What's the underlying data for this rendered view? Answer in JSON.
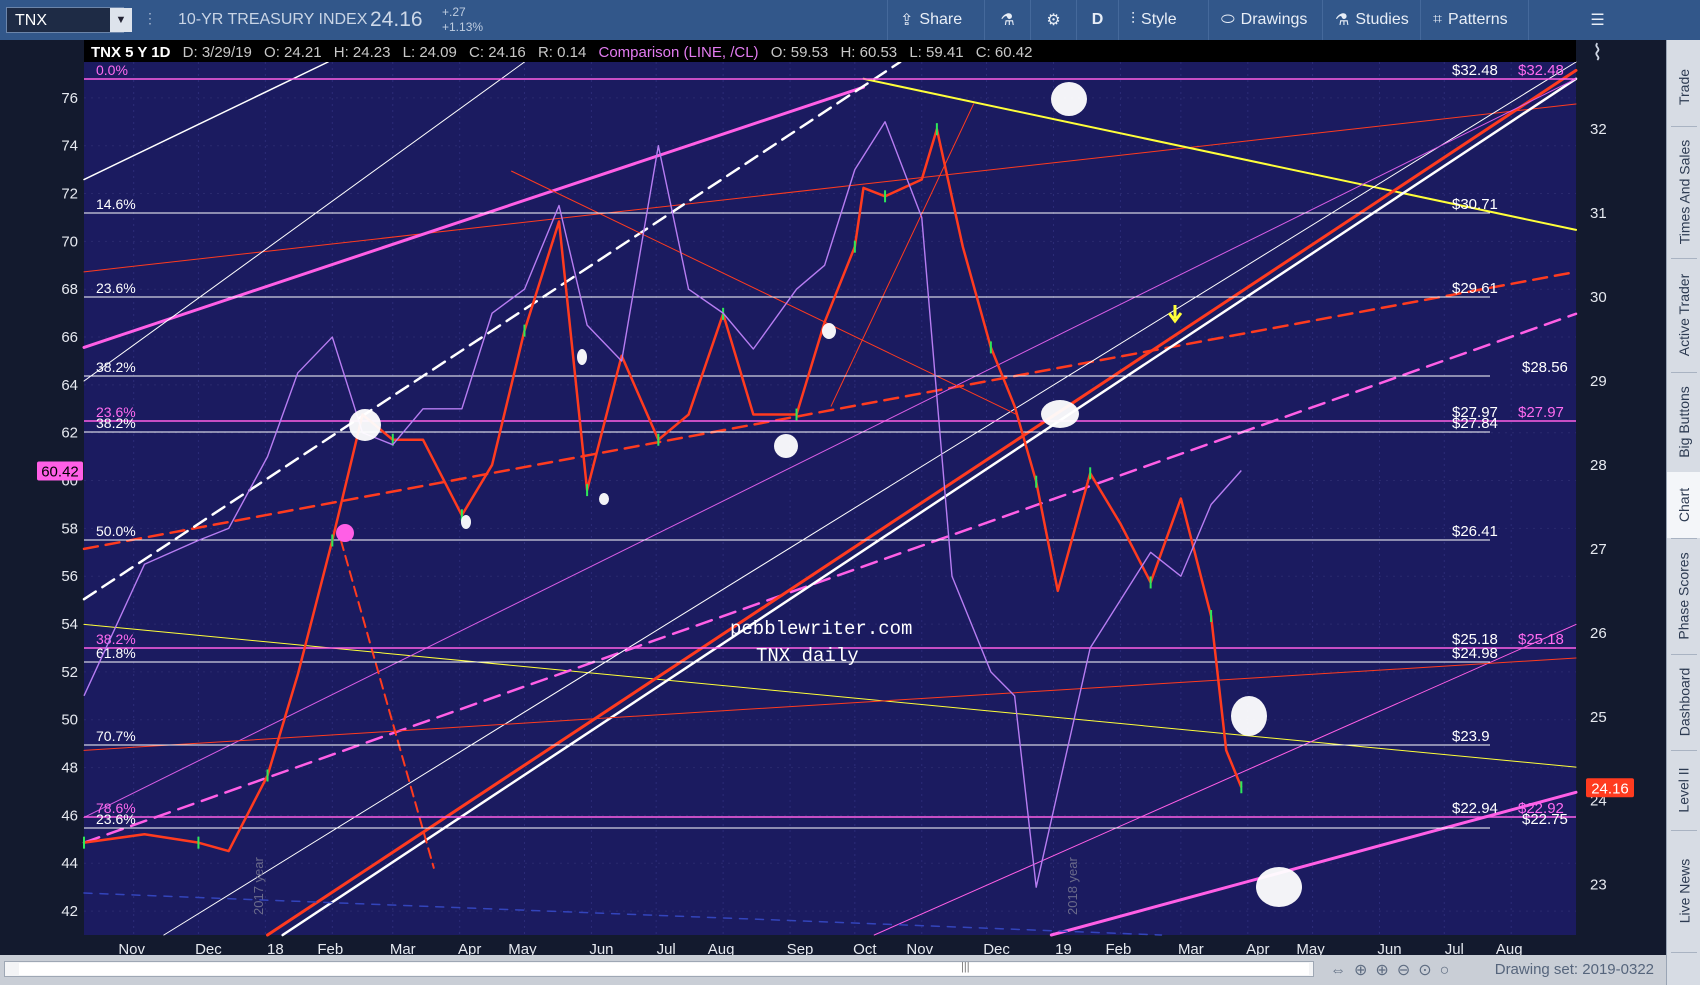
{
  "toolbar": {
    "symbol": "TNX",
    "dropdown_icon": "chevron-down-icon",
    "name": "10-YR TREASURY INDEX",
    "last": "24.16",
    "change": "+.27",
    "change_pct": "+1.13%",
    "share": "Share",
    "period": "D",
    "style": "Style",
    "drawings": "Drawings",
    "studies": "Studies",
    "patterns": "Patterns"
  },
  "header": {
    "title": "TNX 5 Y 1D",
    "date": "D: 3/29/19",
    "open": "O: 24.21",
    "high": "H: 24.23",
    "low": "L: 24.09",
    "close": "C: 24.16",
    "range": "R: 0.14",
    "comparison": "Comparison (LINE, /CL)",
    "c_open": "O: 59.53",
    "c_high": "H: 60.53",
    "c_low": "L: 59.41",
    "c_close": "C: 60.42"
  },
  "sidebar": {
    "tabs": [
      "Trade",
      "Times And Sales",
      "Active Trader",
      "Big Buttons",
      "Chart",
      "Phase Scores",
      "Dashboard",
      "Level II",
      "Live News"
    ],
    "active": "Chart"
  },
  "bottombar": {
    "drawing_set": "Drawing set: 2019-0322"
  },
  "chart_data": {
    "type": "line",
    "annotations": [
      "pebblewriter.com",
      "TNX daily",
      "2017 year",
      "2018 year"
    ],
    "x_ticks": [
      "Nov",
      "Dec",
      "18",
      "Feb",
      "Mar",
      "Apr",
      "May",
      "Jun",
      "Jul",
      "Aug",
      "Sep",
      "Oct",
      "Nov",
      "Dec",
      "19",
      "Feb",
      "Mar",
      "Apr",
      "May",
      "Jun",
      "Jul",
      "Aug"
    ],
    "left_axis": {
      "range": [
        41,
        77.5
      ],
      "ticks": [
        42,
        44,
        46,
        48,
        50,
        52,
        54,
        56,
        58,
        60,
        62,
        64,
        66,
        68,
        70,
        72,
        74,
        76
      ],
      "marker": "60.42"
    },
    "right_axis": {
      "range": [
        22.4,
        32.8
      ],
      "ticks": [
        23,
        24,
        25,
        26,
        27,
        28,
        29,
        30,
        31,
        32
      ],
      "marker": "24.16"
    },
    "fib_levels": [
      {
        "pct": "0.0%",
        "value": "$32.48",
        "right_tag": "$32.48"
      },
      {
        "pct": "14.6%",
        "value": "$30.71"
      },
      {
        "pct": "23.6%",
        "value": "$29.61"
      },
      {
        "pct": "38.2%",
        "value": "$28.56"
      },
      {
        "pct": "23.6%",
        "value": "$27.97",
        "right_tag": "$27.97"
      },
      {
        "pct": "38.2%",
        "value": "$27.84"
      },
      {
        "pct": "50.0%",
        "value": "$26.41"
      },
      {
        "pct": "38.2%",
        "value": "$25.18",
        "right_tag": "$25.18"
      },
      {
        "pct": "61.8%",
        "value": "$24.98"
      },
      {
        "pct": "70.7%",
        "value": "$23.9"
      },
      {
        "pct": "78.6%",
        "value": "$22.94",
        "right_tag": "$22.92"
      },
      {
        "pct": "23.6%",
        "value": "$22.75"
      }
    ],
    "series": [
      {
        "name": "TNX",
        "x": [
          "2017-10-09",
          "2017-11-06",
          "2017-12-01",
          "2017-12-15",
          "2018-01-02",
          "2018-01-16",
          "2018-02-01",
          "2018-02-15",
          "2018-03-01",
          "2018-03-15",
          "2018-04-02",
          "2018-04-16",
          "2018-05-01",
          "2018-05-17",
          "2018-05-30",
          "2018-06-15",
          "2018-07-02",
          "2018-07-16",
          "2018-08-01",
          "2018-08-15",
          "2018-09-04",
          "2018-09-17",
          "2018-10-01",
          "2018-10-05",
          "2018-10-15",
          "2018-11-01",
          "2018-11-08",
          "2018-11-20",
          "2018-12-03",
          "2018-12-14",
          "2018-12-24",
          "2019-01-03",
          "2019-01-18",
          "2019-02-01",
          "2019-02-15",
          "2019-03-01",
          "2019-03-15",
          "2019-03-22",
          "2019-03-29"
        ],
        "values": [
          23.5,
          23.6,
          23.5,
          23.4,
          24.3,
          25.5,
          27.1,
          28.6,
          28.3,
          28.3,
          27.4,
          28.0,
          29.6,
          30.9,
          27.7,
          29.3,
          28.3,
          28.6,
          29.8,
          28.6,
          28.6,
          29.7,
          30.6,
          31.3,
          31.2,
          31.4,
          32.0,
          30.6,
          29.4,
          28.7,
          27.8,
          26.5,
          27.9,
          27.3,
          26.6,
          27.6,
          26.2,
          24.6,
          24.16
        ],
        "color": "#ff3b1f"
      },
      {
        "name": "/CL",
        "x": [
          "2017-10-09",
          "2017-11-06",
          "2017-12-01",
          "2017-12-15",
          "2018-01-02",
          "2018-01-16",
          "2018-02-01",
          "2018-02-15",
          "2018-03-01",
          "2018-03-15",
          "2018-04-02",
          "2018-04-16",
          "2018-05-01",
          "2018-05-17",
          "2018-05-30",
          "2018-06-15",
          "2018-07-02",
          "2018-07-16",
          "2018-08-01",
          "2018-08-15",
          "2018-09-04",
          "2018-09-17",
          "2018-10-01",
          "2018-10-15",
          "2018-11-01",
          "2018-11-15",
          "2018-12-03",
          "2018-12-14",
          "2018-12-24",
          "2019-01-03",
          "2019-01-18",
          "2019-02-01",
          "2019-02-15",
          "2019-03-01",
          "2019-03-15",
          "2019-03-29"
        ],
        "values": [
          51,
          56.5,
          57.5,
          58,
          61,
          64.5,
          66,
          62,
          61.5,
          63,
          63,
          67,
          68,
          71.5,
          66.5,
          65,
          74,
          68,
          67,
          65.5,
          68,
          69,
          73,
          75,
          71,
          56,
          52,
          51,
          43,
          47,
          53,
          55,
          57,
          56,
          59,
          60.42
        ],
        "color": "#b77df2"
      }
    ]
  }
}
